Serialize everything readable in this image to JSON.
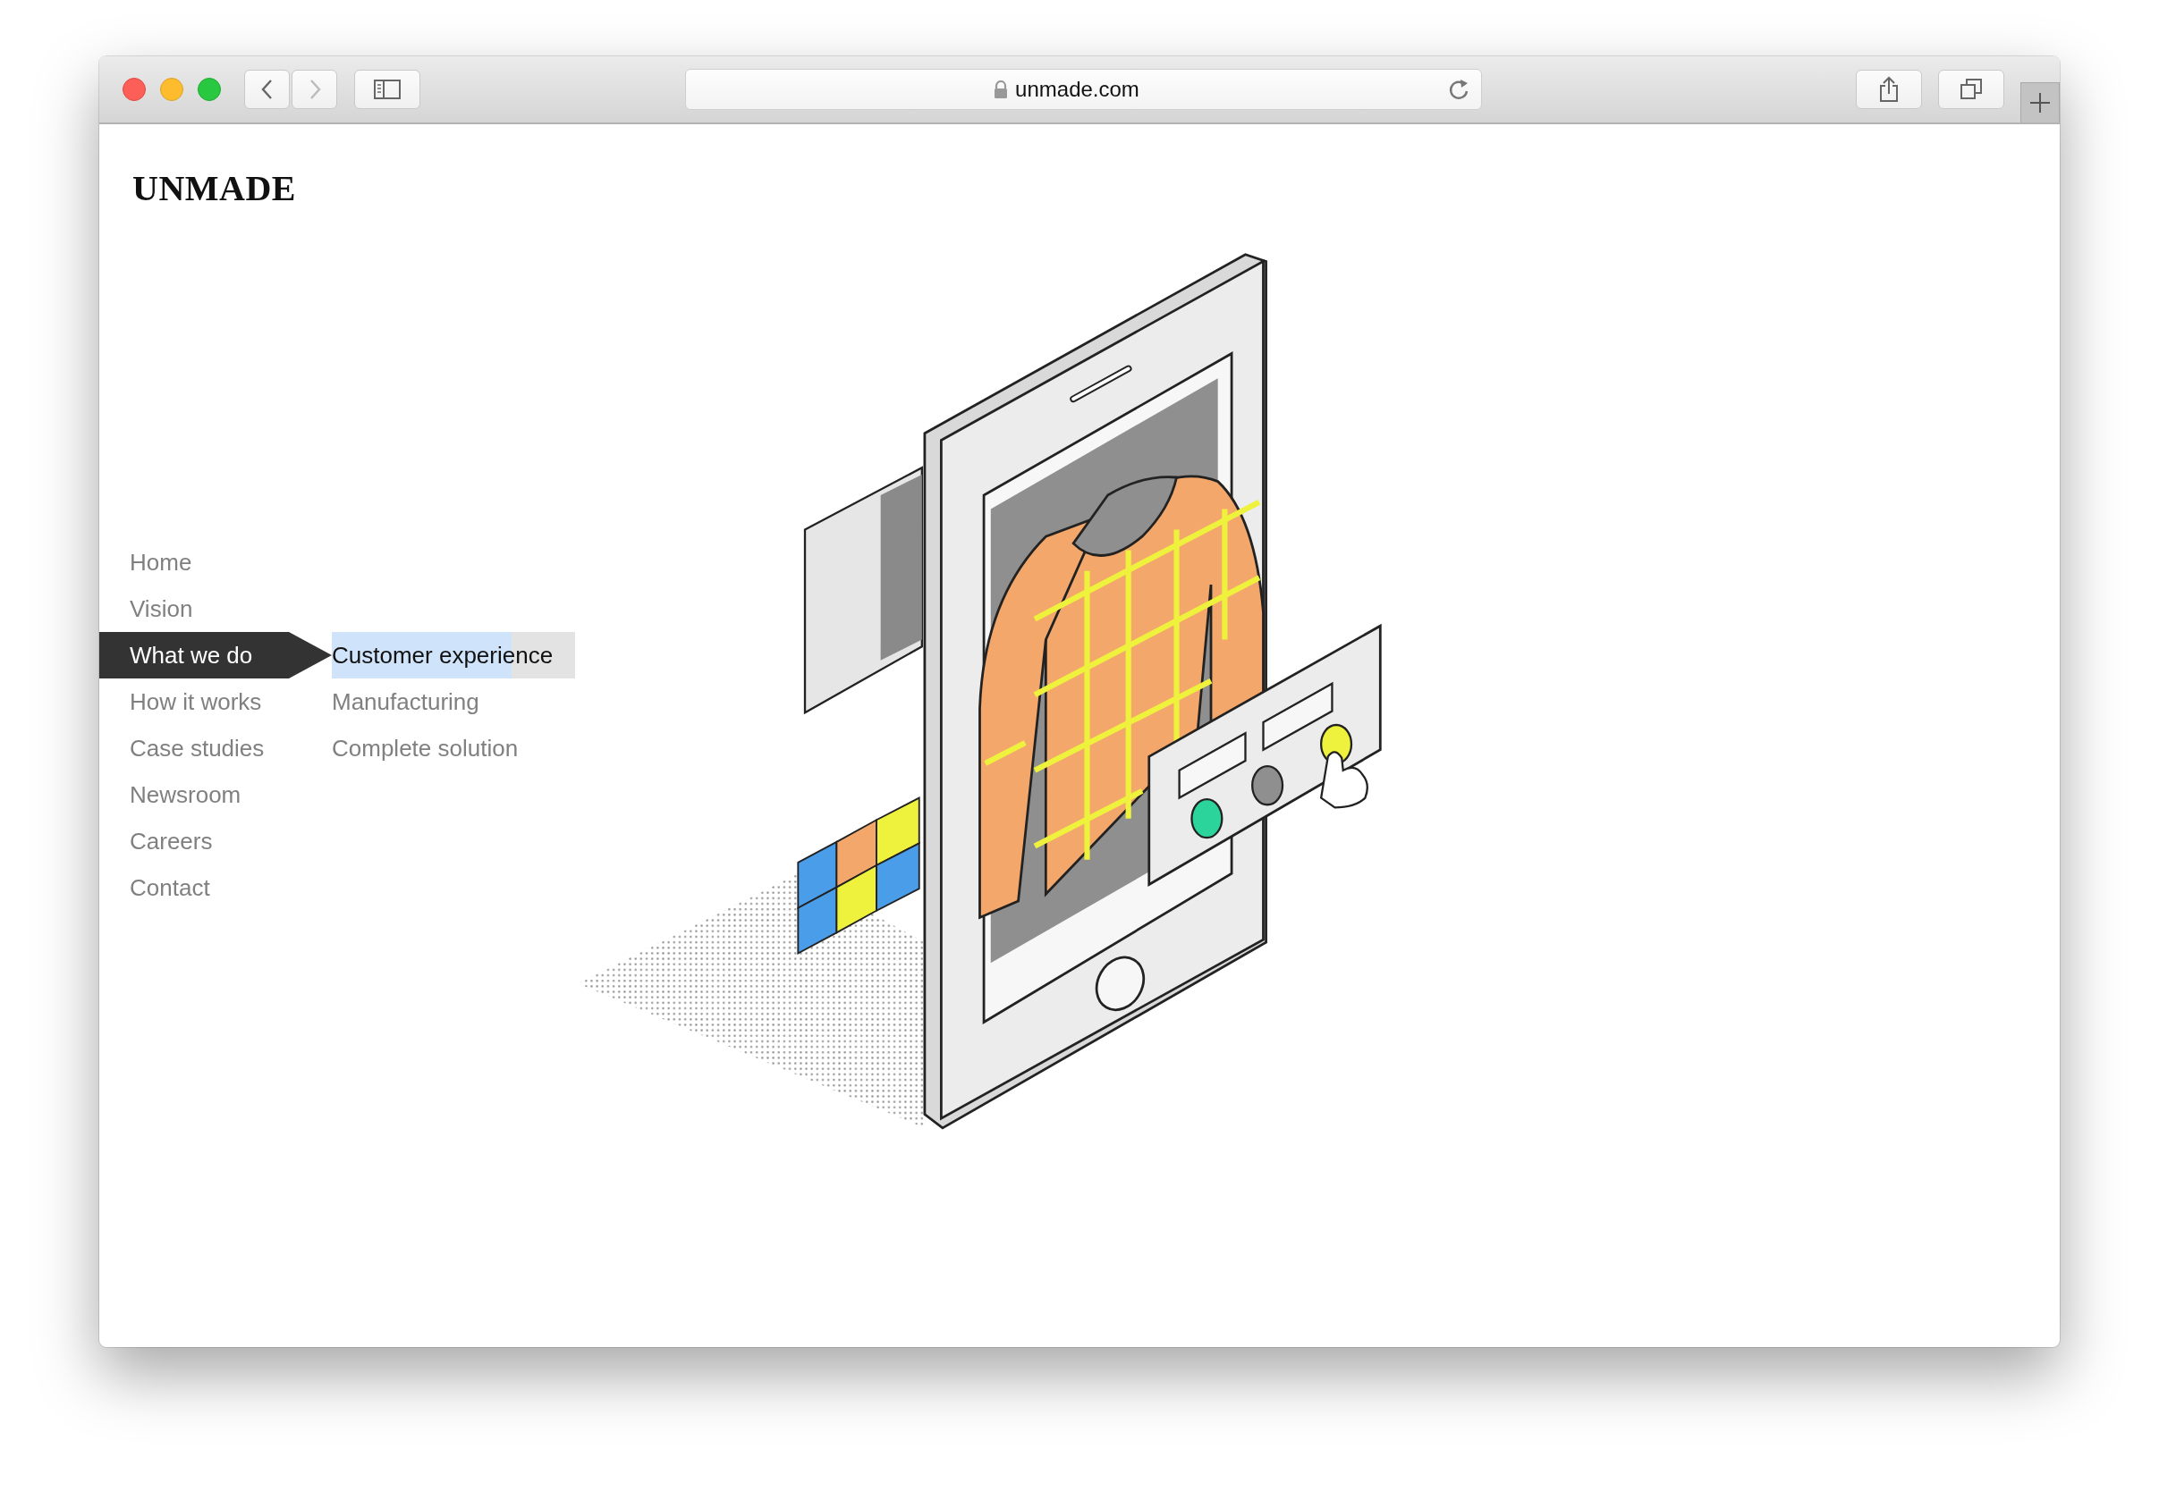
{
  "browser": {
    "url": "unmade.com"
  },
  "logo": "UNMADE",
  "nav": {
    "items": [
      {
        "label": "Home",
        "selected": false
      },
      {
        "label": "Vision",
        "selected": false
      },
      {
        "label": "What we do",
        "selected": true
      },
      {
        "label": "How it works",
        "selected": false
      },
      {
        "label": "Case studies",
        "selected": false
      },
      {
        "label": "Newsroom",
        "selected": false
      },
      {
        "label": "Careers",
        "selected": false
      },
      {
        "label": "Contact",
        "selected": false
      }
    ],
    "subitems": [
      {
        "label": "Customer experience",
        "selected": true,
        "level": 0.74
      },
      {
        "label": "Manufacturing",
        "selected": false
      },
      {
        "label": "Complete solution",
        "selected": false
      }
    ]
  }
}
